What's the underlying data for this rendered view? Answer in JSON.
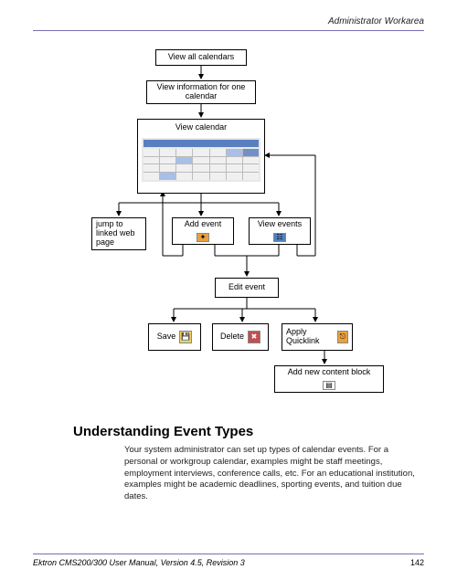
{
  "header": {
    "breadcrumb": "Administrator Workarea"
  },
  "diagram": {
    "n1": "View all calendars",
    "n2": "View information for one calendar",
    "n3": "View calendar",
    "n4": "jump to linked web page",
    "n5": "Add event",
    "n6": "View events",
    "n7": "Edit event",
    "n8": "Save",
    "n9": "Delete",
    "n10": "Apply Quicklink",
    "n11": "Add new content block",
    "icons": {
      "add_event": "add-event-icon",
      "view_events": "view-events-icon",
      "save": "save-icon",
      "delete": "delete-icon",
      "apply_quicklink": "quicklink-icon",
      "add_content": "add-content-icon"
    }
  },
  "section": {
    "heading": "Understanding Event Types",
    "body": "Your system administrator can set up types of calendar events. For a personal or workgroup calendar, examples might be staff meetings, employment interviews, conference calls, etc. For an educational institution, examples might be academic deadlines, sporting events, and tuition due dates."
  },
  "footer": {
    "title": "Ektron CMS200/300 User Manual, Version 4.5, Revision 3",
    "page": "142"
  }
}
